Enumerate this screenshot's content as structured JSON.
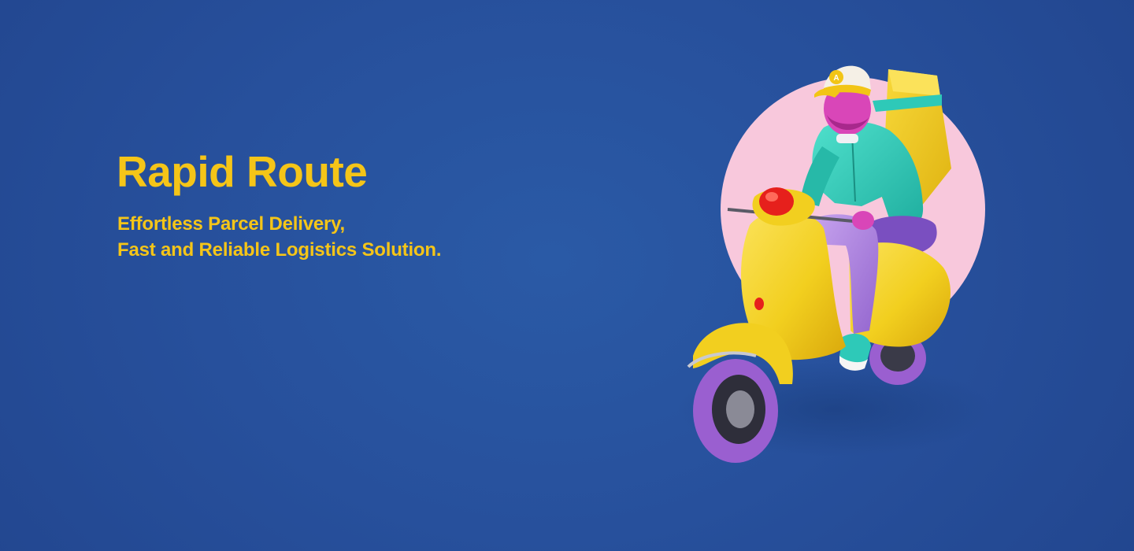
{
  "hero": {
    "title": "Rapid Route",
    "tagline_line1": "Effortless Parcel Delivery,",
    "tagline_line2": "Fast and Reliable Logistics Solution."
  },
  "illustration": {
    "cap_logo": "A",
    "icon": "delivery-rider-scooter-illustration"
  },
  "colors": {
    "background": "#27509c",
    "accent_yellow": "#f5c518",
    "circle_pink": "#f8c8dc",
    "scooter_yellow": "#f2cf1f",
    "tire_purple": "#9a5fd0",
    "jacket_teal": "#2ec9b8",
    "pants_purple": "#b088e0",
    "seat_purple": "#7a4fc0",
    "lamp_red": "#e6201c"
  }
}
